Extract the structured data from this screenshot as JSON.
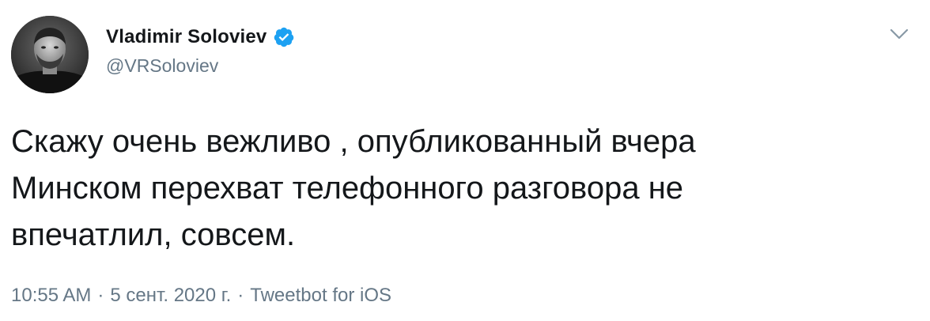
{
  "author": {
    "display_name": "Vladimir Soloviev",
    "handle": "@VRSoloviev",
    "verified": true,
    "avatar_icon": "profile-photo-icon"
  },
  "tweet": {
    "text": "Скажу очень вежливо , опубликованный вчера\nМинском перехват телефонного разговора не\nвпечатлил, совсем."
  },
  "meta": {
    "time": "10:55 AM",
    "separator": "·",
    "date": "5 сент. 2020 г.",
    "source": "Tweetbot for iOS"
  },
  "colors": {
    "text": "#14171a",
    "secondary": "#657786",
    "verified_badge": "#1da1f2"
  },
  "icons": {
    "verified": "verified-badge-icon",
    "menu": "chevron-down-icon"
  }
}
